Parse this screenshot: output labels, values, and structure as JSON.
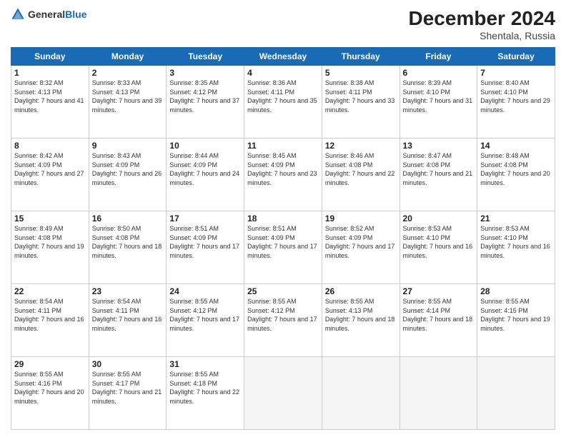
{
  "header": {
    "logo_general": "General",
    "logo_blue": "Blue",
    "month_year": "December 2024",
    "location": "Shentala, Russia"
  },
  "days_of_week": [
    "Sunday",
    "Monday",
    "Tuesday",
    "Wednesday",
    "Thursday",
    "Friday",
    "Saturday"
  ],
  "cells": [
    {
      "day": "",
      "info": ""
    },
    {
      "day": "",
      "info": ""
    },
    {
      "day": "",
      "info": ""
    },
    {
      "day": "",
      "info": ""
    },
    {
      "day": "",
      "info": ""
    },
    {
      "day": "",
      "info": ""
    },
    {
      "day": "",
      "info": ""
    },
    {
      "day": "1",
      "info": "Sunrise: 8:32 AM\nSunset: 4:13 PM\nDaylight: 7 hours and 41 minutes."
    },
    {
      "day": "2",
      "info": "Sunrise: 8:33 AM\nSunset: 4:13 PM\nDaylight: 7 hours and 39 minutes."
    },
    {
      "day": "3",
      "info": "Sunrise: 8:35 AM\nSunset: 4:12 PM\nDaylight: 7 hours and 37 minutes."
    },
    {
      "day": "4",
      "info": "Sunrise: 8:36 AM\nSunset: 4:11 PM\nDaylight: 7 hours and 35 minutes."
    },
    {
      "day": "5",
      "info": "Sunrise: 8:38 AM\nSunset: 4:11 PM\nDaylight: 7 hours and 33 minutes."
    },
    {
      "day": "6",
      "info": "Sunrise: 8:39 AM\nSunset: 4:10 PM\nDaylight: 7 hours and 31 minutes."
    },
    {
      "day": "7",
      "info": "Sunrise: 8:40 AM\nSunset: 4:10 PM\nDaylight: 7 hours and 29 minutes."
    },
    {
      "day": "8",
      "info": "Sunrise: 8:42 AM\nSunset: 4:09 PM\nDaylight: 7 hours and 27 minutes."
    },
    {
      "day": "9",
      "info": "Sunrise: 8:43 AM\nSunset: 4:09 PM\nDaylight: 7 hours and 26 minutes."
    },
    {
      "day": "10",
      "info": "Sunrise: 8:44 AM\nSunset: 4:09 PM\nDaylight: 7 hours and 24 minutes."
    },
    {
      "day": "11",
      "info": "Sunrise: 8:45 AM\nSunset: 4:09 PM\nDaylight: 7 hours and 23 minutes."
    },
    {
      "day": "12",
      "info": "Sunrise: 8:46 AM\nSunset: 4:08 PM\nDaylight: 7 hours and 22 minutes."
    },
    {
      "day": "13",
      "info": "Sunrise: 8:47 AM\nSunset: 4:08 PM\nDaylight: 7 hours and 21 minutes."
    },
    {
      "day": "14",
      "info": "Sunrise: 8:48 AM\nSunset: 4:08 PM\nDaylight: 7 hours and 20 minutes."
    },
    {
      "day": "15",
      "info": "Sunrise: 8:49 AM\nSunset: 4:08 PM\nDaylight: 7 hours and 19 minutes."
    },
    {
      "day": "16",
      "info": "Sunrise: 8:50 AM\nSunset: 4:08 PM\nDaylight: 7 hours and 18 minutes."
    },
    {
      "day": "17",
      "info": "Sunrise: 8:51 AM\nSunset: 4:09 PM\nDaylight: 7 hours and 17 minutes."
    },
    {
      "day": "18",
      "info": "Sunrise: 8:51 AM\nSunset: 4:09 PM\nDaylight: 7 hours and 17 minutes."
    },
    {
      "day": "19",
      "info": "Sunrise: 8:52 AM\nSunset: 4:09 PM\nDaylight: 7 hours and 17 minutes."
    },
    {
      "day": "20",
      "info": "Sunrise: 8:53 AM\nSunset: 4:10 PM\nDaylight: 7 hours and 16 minutes."
    },
    {
      "day": "21",
      "info": "Sunrise: 8:53 AM\nSunset: 4:10 PM\nDaylight: 7 hours and 16 minutes."
    },
    {
      "day": "22",
      "info": "Sunrise: 8:54 AM\nSunset: 4:11 PM\nDaylight: 7 hours and 16 minutes."
    },
    {
      "day": "23",
      "info": "Sunrise: 8:54 AM\nSunset: 4:11 PM\nDaylight: 7 hours and 16 minutes."
    },
    {
      "day": "24",
      "info": "Sunrise: 8:55 AM\nSunset: 4:12 PM\nDaylight: 7 hours and 17 minutes."
    },
    {
      "day": "25",
      "info": "Sunrise: 8:55 AM\nSunset: 4:12 PM\nDaylight: 7 hours and 17 minutes."
    },
    {
      "day": "26",
      "info": "Sunrise: 8:55 AM\nSunset: 4:13 PM\nDaylight: 7 hours and 18 minutes."
    },
    {
      "day": "27",
      "info": "Sunrise: 8:55 AM\nSunset: 4:14 PM\nDaylight: 7 hours and 18 minutes."
    },
    {
      "day": "28",
      "info": "Sunrise: 8:55 AM\nSunset: 4:15 PM\nDaylight: 7 hours and 19 minutes."
    },
    {
      "day": "29",
      "info": "Sunrise: 8:55 AM\nSunset: 4:16 PM\nDaylight: 7 hours and 20 minutes."
    },
    {
      "day": "30",
      "info": "Sunrise: 8:55 AM\nSunset: 4:17 PM\nDaylight: 7 hours and 21 minutes."
    },
    {
      "day": "31",
      "info": "Sunrise: 8:55 AM\nSunset: 4:18 PM\nDaylight: 7 hours and 22 minutes."
    },
    {
      "day": "",
      "info": ""
    },
    {
      "day": "",
      "info": ""
    },
    {
      "day": "",
      "info": ""
    },
    {
      "day": "",
      "info": ""
    },
    {
      "day": "",
      "info": ""
    }
  ]
}
